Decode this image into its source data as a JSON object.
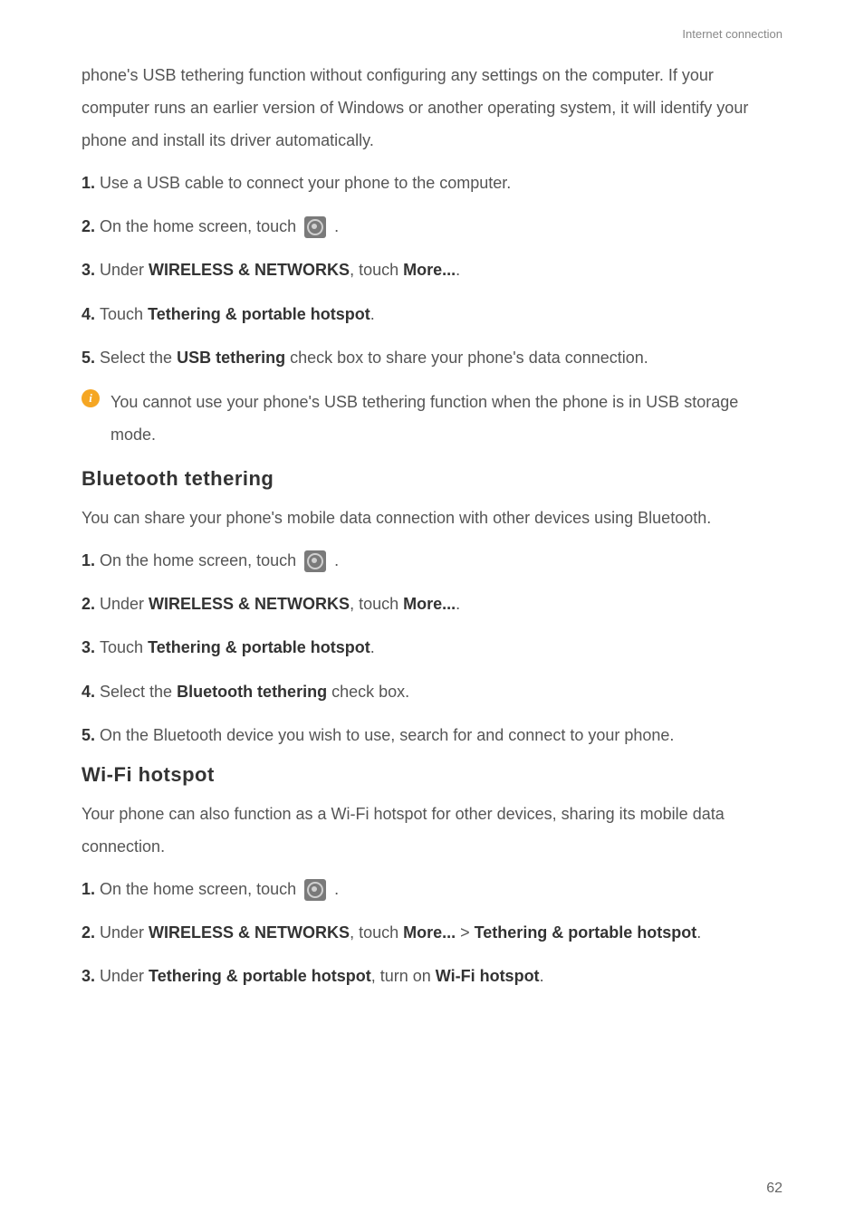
{
  "header": {
    "section": "Internet connection"
  },
  "intro": {
    "para": "phone's USB tethering function without configuring any settings on the computer. If your computer runs an earlier version of Windows or another operating system, it will identify your phone and install its driver automatically."
  },
  "usb_steps": {
    "s1_num": "1. ",
    "s1_text": "Use a USB cable to connect your phone to the computer.",
    "s2_num": "2. ",
    "s2_text": "On the home screen, touch ",
    "s2_suffix": " .",
    "s3_num": "3. ",
    "s3_text": "Under ",
    "s3_bold1": "WIRELESS & NETWORKS",
    "s3_mid": ", touch ",
    "s3_bold2": "More...",
    "s3_end": ".",
    "s4_num": "4. ",
    "s4_text": "Touch ",
    "s4_bold": "Tethering & portable hotspot",
    "s4_end": ".",
    "s5_num": "5. ",
    "s5_text": "Select the ",
    "s5_bold": "USB tethering",
    "s5_end": " check box to share your phone's data connection."
  },
  "info": {
    "icon": "i",
    "text": "You cannot use your phone's USB tethering function when the phone is in USB storage mode."
  },
  "bluetooth": {
    "heading": "Bluetooth tethering",
    "intro": "You can share your phone's mobile data connection with other devices using Bluetooth.",
    "s1_num": "1. ",
    "s1_text": "On the home screen, touch ",
    "s1_suffix": " .",
    "s2_num": "2. ",
    "s2_text": "Under ",
    "s2_bold1": "WIRELESS & NETWORKS",
    "s2_mid": ", touch ",
    "s2_bold2": "More...",
    "s2_end": ".",
    "s3_num": "3. ",
    "s3_text": "Touch ",
    "s3_bold": "Tethering & portable hotspot",
    "s3_end": ".",
    "s4_num": "4. ",
    "s4_text": "Select the ",
    "s4_bold": "Bluetooth tethering",
    "s4_end": " check box.",
    "s5_num": "5. ",
    "s5_text": "On the Bluetooth device you wish to use, search for and connect to your phone."
  },
  "wifi": {
    "heading": "Wi-Fi hotspot",
    "intro": "Your phone can also function as a Wi-Fi hotspot for other devices, sharing its mobile data connection.",
    "s1_num": "1. ",
    "s1_text": "On the home screen, touch ",
    "s1_suffix": " .",
    "s2_num": "2. ",
    "s2_text": "Under ",
    "s2_bold1": "WIRELESS & NETWORKS",
    "s2_mid": ", touch ",
    "s2_bold2": "More...",
    "s2_gt": " > ",
    "s2_bold3": "Tethering & portable hotspot",
    "s2_end": ".",
    "s3_num": "3. ",
    "s3_text": "Under ",
    "s3_bold1": "Tethering & portable hotspot",
    "s3_mid": ", turn on ",
    "s3_bold2": "Wi-Fi hotspot",
    "s3_end": "."
  },
  "page": {
    "number": "62"
  }
}
